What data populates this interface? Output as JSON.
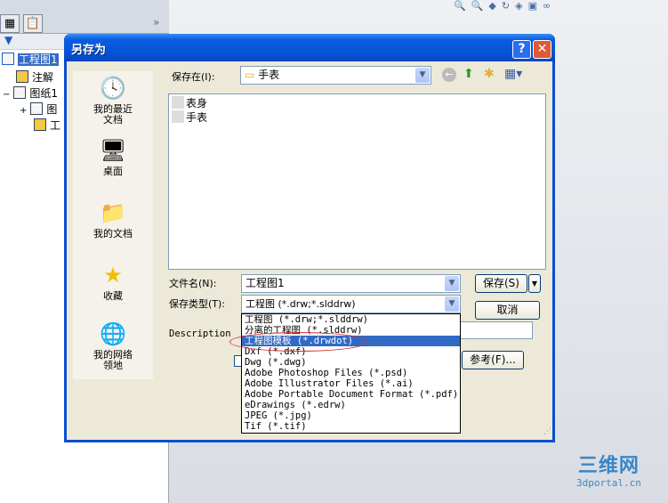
{
  "app": {
    "toolbar_icons": [
      "zoom-fit-icon",
      "zoom-area-icon",
      "previous-view-icon",
      "rotate-icon",
      "display-style-icon",
      "view-orientation-icon",
      "hide-show-icon"
    ]
  },
  "left_panel": {
    "chevron": "»",
    "tree": [
      {
        "label": "工程图1",
        "icon": "drawing-icon",
        "selected": true
      },
      {
        "label": "注解",
        "icon": "annotation-icon"
      },
      {
        "label": "图纸1",
        "icon": "sheet-icon",
        "expander": "−"
      },
      {
        "label": "图",
        "icon": "sheet-format-icon",
        "expander": "+"
      },
      {
        "label": "工",
        "icon": "folder-icon"
      }
    ]
  },
  "dialog": {
    "title": "另存为",
    "help": "?",
    "close": "✕",
    "places": [
      {
        "label": "我的最近\n文档",
        "icon": "recent-documents-icon"
      },
      {
        "label": "桌面",
        "icon": "desktop-icon"
      },
      {
        "label": "我的文档",
        "icon": "my-documents-icon"
      },
      {
        "label": "收藏",
        "icon": "favorites-star-icon"
      },
      {
        "label": "我的网络\n领地",
        "icon": "network-places-icon"
      }
    ],
    "save_in_label": "保存在(I):",
    "save_in_value": "手表",
    "files": [
      "表身",
      "手表"
    ],
    "filename_label": "文件名(N):",
    "filename_value": "工程图1",
    "filetype_label": "保存类型(T):",
    "filetype_value": "工程图 (*.drw;*.slddrw)",
    "save_button": "保存(S)",
    "cancel_button": "取消",
    "description_label": "Description",
    "reference_button": "参考(F)...",
    "filetype_options": [
      "工程图 (*.drw;*.slddrw)",
      "分离的工程图 (*.slddrw)",
      "工程图模板 (*.drwdot)",
      "Dxf (*.dxf)",
      "Dwg (*.dwg)",
      "Adobe Photoshop Files (*.psd)",
      "Adobe Illustrator Files (*.ai)",
      "Adobe Portable Document Format (*.pdf)",
      "eDrawings (*.edrw)",
      "JPEG (*.jpg)",
      "Tif (*.tif)"
    ],
    "highlighted_option_index": 2,
    "annotation_color": "#d03030"
  },
  "watermark": {
    "line1": "三维网",
    "line2": "3dportal.cn"
  }
}
